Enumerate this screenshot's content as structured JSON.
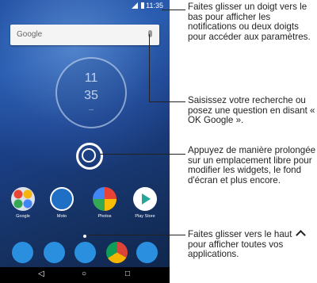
{
  "status_bar": {
    "time": "11:35"
  },
  "search": {
    "logo": "Google"
  },
  "clock_widget": {
    "line1": "11",
    "line2": "35",
    "line3": "—"
  },
  "apps": [
    {
      "label": "Google",
      "icon": "google-folder-icon"
    },
    {
      "label": "Moto",
      "icon": "moto-icon"
    },
    {
      "label": "Photos",
      "icon": "photos-icon"
    },
    {
      "label": "Play Store",
      "icon": "play-store-icon"
    }
  ],
  "dock": [
    {
      "icon": "phone-icon",
      "color": "#2b8fe0"
    },
    {
      "icon": "messages-icon",
      "color": "#2b8fe0"
    },
    {
      "icon": "contacts-icon",
      "color": "#2b8fe0"
    },
    {
      "icon": "chrome-icon",
      "color": "#d9d9d9"
    },
    {
      "icon": "camera-icon",
      "color": "#2b8fe0"
    }
  ],
  "navbar": {
    "back": "◁",
    "home": "○",
    "recents": "□"
  },
  "callouts": {
    "status": "Faites glisser un doigt vers le bas pour afficher les notifications ou deux doigts pour accéder aux paramètres.",
    "search": "Saisissez votre recherche ou posez une question en disant « OK Google ».",
    "longpress": "Appuyez de manière prolongée sur un emplacement libre pour modifier les widgets, le fond d'écran et plus encore.",
    "apps_before": "Faites glisser vers le haut",
    "apps_after": "pour afficher toutes vos applications."
  }
}
